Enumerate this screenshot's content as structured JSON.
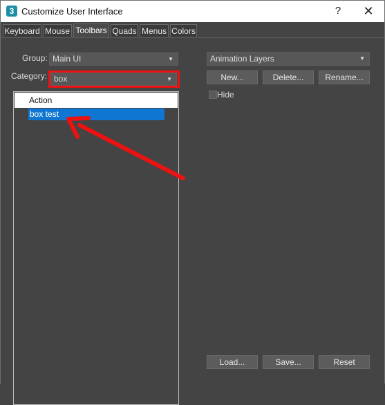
{
  "window": {
    "title": "Customize User Interface",
    "help": "?",
    "close": "✕",
    "app_icon": "3"
  },
  "tabs": [
    {
      "label": "Keyboard"
    },
    {
      "label": "Mouse"
    },
    {
      "label": "Toolbars"
    },
    {
      "label": "Quads"
    },
    {
      "label": "Menus"
    },
    {
      "label": "Colors"
    }
  ],
  "active_tab": "Toolbars",
  "left": {
    "group_label": "Group:",
    "group_value": "Main UI",
    "category_label": "Category:",
    "category_value": "box",
    "list_header": "Action",
    "list_items": [
      "box test"
    ]
  },
  "right": {
    "toolbar_value": "Animation Layers",
    "new_label": "New...",
    "delete_label": "Delete...",
    "rename_label": "Rename...",
    "hide_label": "Hide",
    "load_label": "Load...",
    "save_label": "Save...",
    "reset_label": "Reset"
  },
  "icons": {
    "dropdown": "▼"
  },
  "colors": {
    "annotation": "#ee1111",
    "selection": "#0f76d2"
  }
}
